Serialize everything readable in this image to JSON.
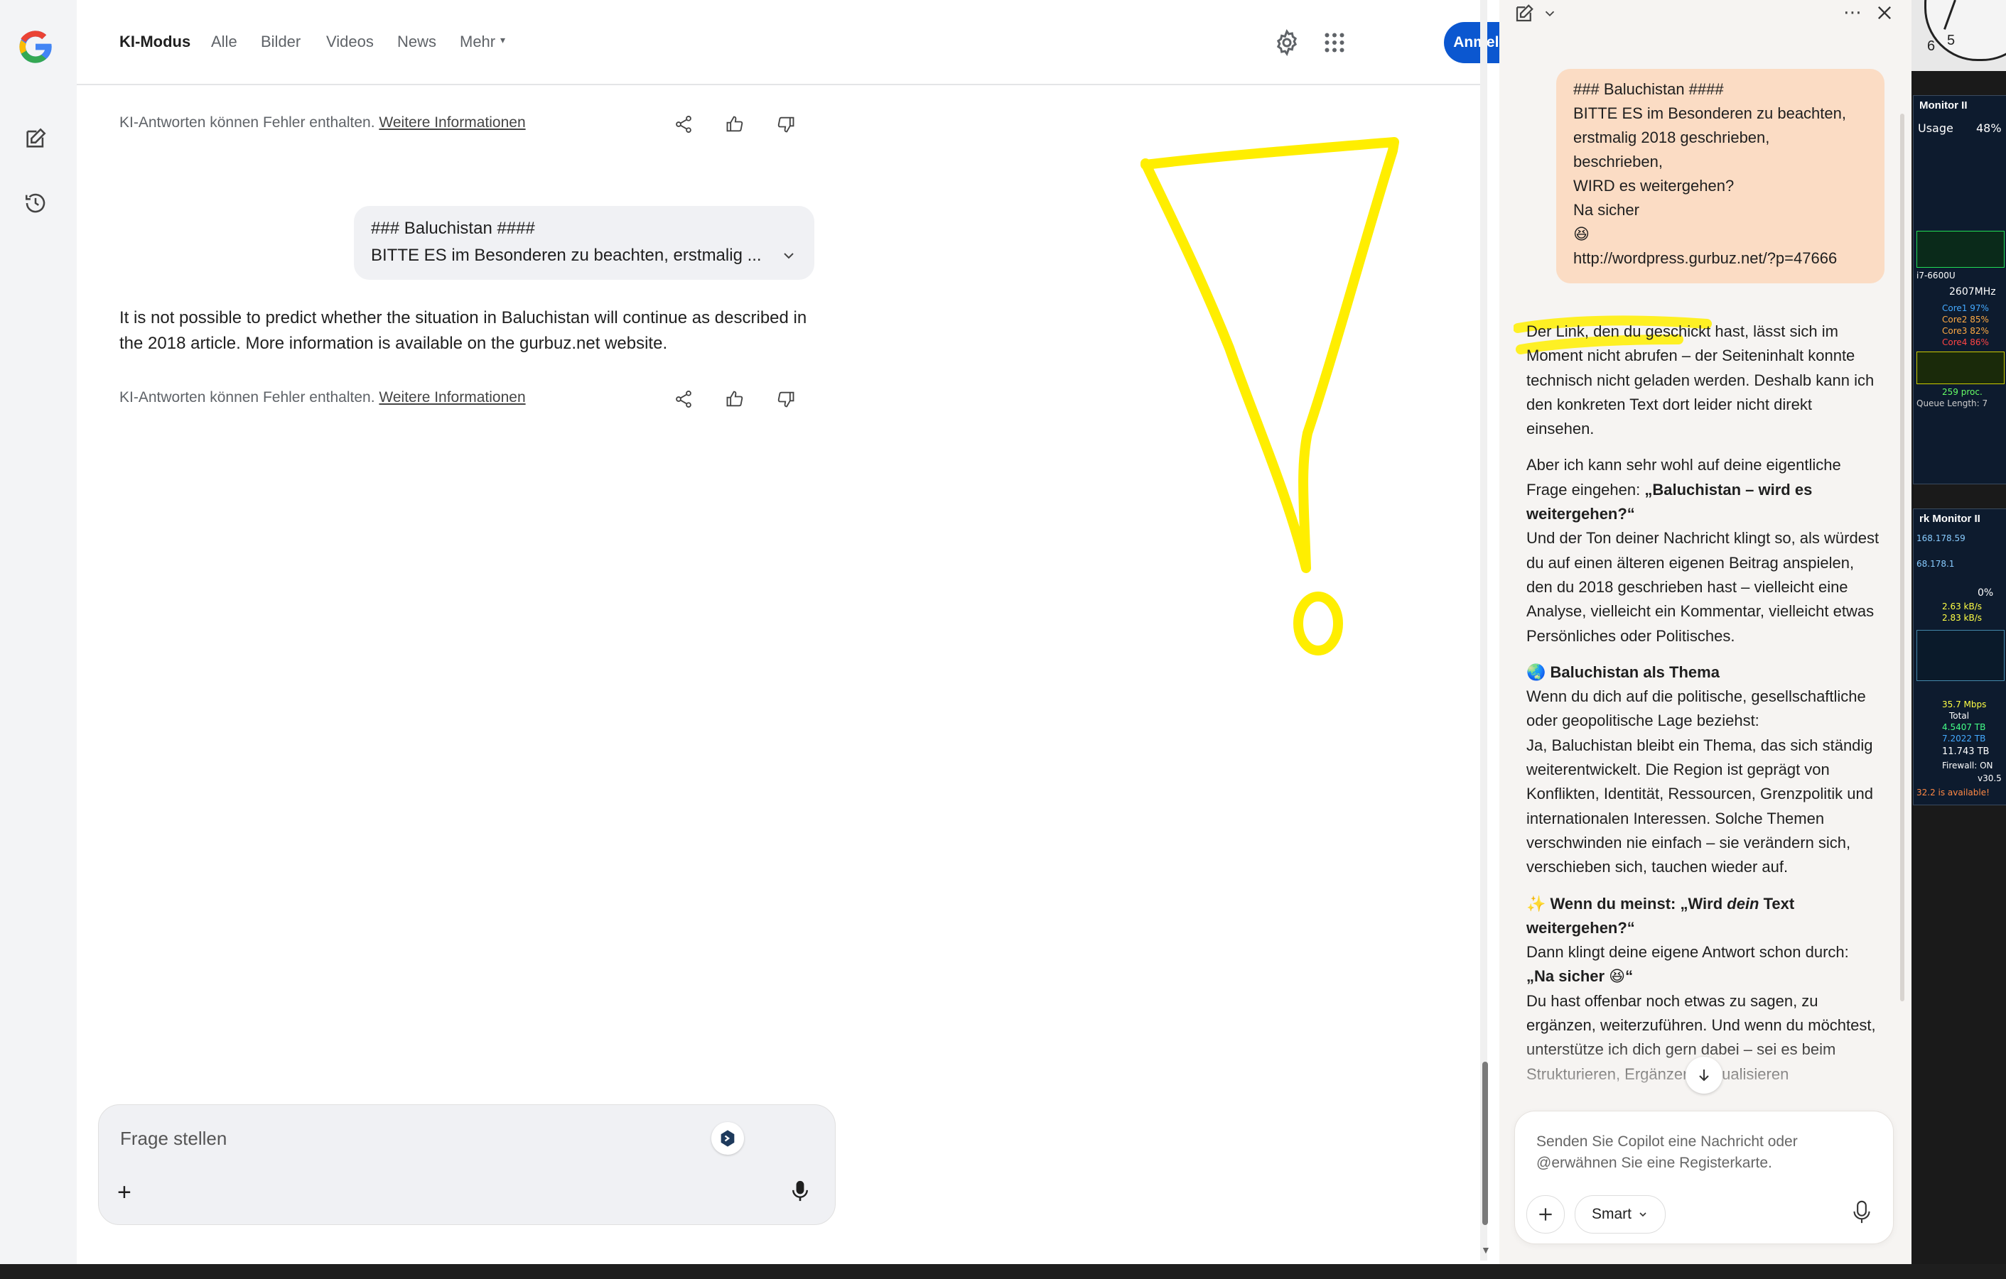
{
  "google": {
    "nav": {
      "items": [
        "KI-Modus",
        "Alle",
        "Bilder",
        "Videos",
        "News",
        "Mehr"
      ],
      "signin_label": "Anmelden"
    },
    "disclaimer": {
      "text": "KI-Antworten können Fehler enthalten.",
      "link": "Weitere Informationen"
    },
    "query": {
      "line1": "### Baluchistan ####",
      "line2": "BITTE ES im Besonderen zu beachten, erstmalig ..."
    },
    "answer": "It is not possible to predict whether the situation in Baluchistan will continue as described in the 2018 article. More information is available on the gurbuz.net website.",
    "ask_placeholder": "Frage stellen"
  },
  "copilot": {
    "user_message": [
      "### Baluchistan ####",
      "BITTE ES im Besonderen zu beachten,",
      "erstmalig 2018 geschrieben,",
      "beschrieben,",
      "WIRD es weitergehen?",
      "Na sicher",
      "😆",
      "http://wordpress.gurbuz.net/?p=47666"
    ],
    "reply": {
      "p1": "Der Link, den du geschickt hast, lässt sich im Moment nicht abrufen – der Seiteninhalt konnte technisch nicht geladen werden. Deshalb kann ich den konkreten Text dort leider nicht direkt einsehen.",
      "p2_intro": "Aber ich kann sehr wohl auf deine eigentliche Frage eingehen: ",
      "p2_bold": "„Baluchistan – wird es weitergehen?“",
      "p2_rest": "Und der Ton deiner Nachricht klingt so, als würdest du auf einen älteren eigenen Beitrag anspielen, den du 2018 geschrieben hast – vielleicht eine Analyse, vielleicht ein Kommentar, vielleicht etwas Persönliches oder Politisches.",
      "p3_heading": "Baluchistan als Thema",
      "p3_intro": "Wenn du dich auf die politische, gesellschaftliche oder geopolitische Lage beziehst:",
      "p3_body": "Ja, Baluchistan bleibt ein Thema, das sich ständig weiterentwickelt. Die Region ist geprägt von Konflikten, Identität, Ressourcen, Grenzpolitik und internationalen Interessen. Solche Themen verschwinden nie einfach – sie verändern sich, verschieben sich, tauchen wieder auf.",
      "p4_heading_a": "Wenn du meinst: „Wird ",
      "p4_heading_em": "dein",
      "p4_heading_b": " Text weitergehen?“",
      "p4_intro": "Dann klingt deine eigene Antwort schon durch:",
      "p4_bold": "„Na sicher 😆“",
      "p4_body": "Du hast offenbar noch etwas zu sagen, zu ergänzen, weiterzuführen. Und wenn du möchtest, unterstütze ich dich gern dabei – sei es beim Strukturieren, Ergänzen, Aktualisieren"
    },
    "input_placeholder": "Senden Sie Copilot eine Nachricht oder @erwähnen Sie eine Registerkarte.",
    "smart_label": "Smart"
  },
  "widgets": {
    "cpu": {
      "title": "Monitor II",
      "usage_label": "Usage",
      "usage": "48%",
      "cpu_name": "i7-6600U",
      "freq": "2607MHz",
      "cores": [
        "Core1 97%",
        "Core2 85%",
        "Core3 82%",
        "Core4 86%"
      ],
      "procs": "259 proc.",
      "queue": "Queue Length: 7"
    },
    "net": {
      "title": "rk Monitor II",
      "ip": "168.178.59",
      "ip2": "68.178.1",
      "usage": "0%",
      "down": "2.63 kB/s",
      "up": "2.83 kB/s",
      "speed": "35.7 Mbps",
      "total_label": "Total",
      "t1": "4.5407 TB",
      "t2": "7.2022 TB",
      "sum": "11.743 TB",
      "firewall": "Firewall: ON",
      "version": "v30.5",
      "notice": "32.2 is available!"
    },
    "clock_digits": [
      "6",
      "5"
    ]
  },
  "colors": {
    "accent_blue": "#0b57d0",
    "copilot_bubble": "#fbdcc4",
    "annotation_yellow": "#ffee00"
  }
}
